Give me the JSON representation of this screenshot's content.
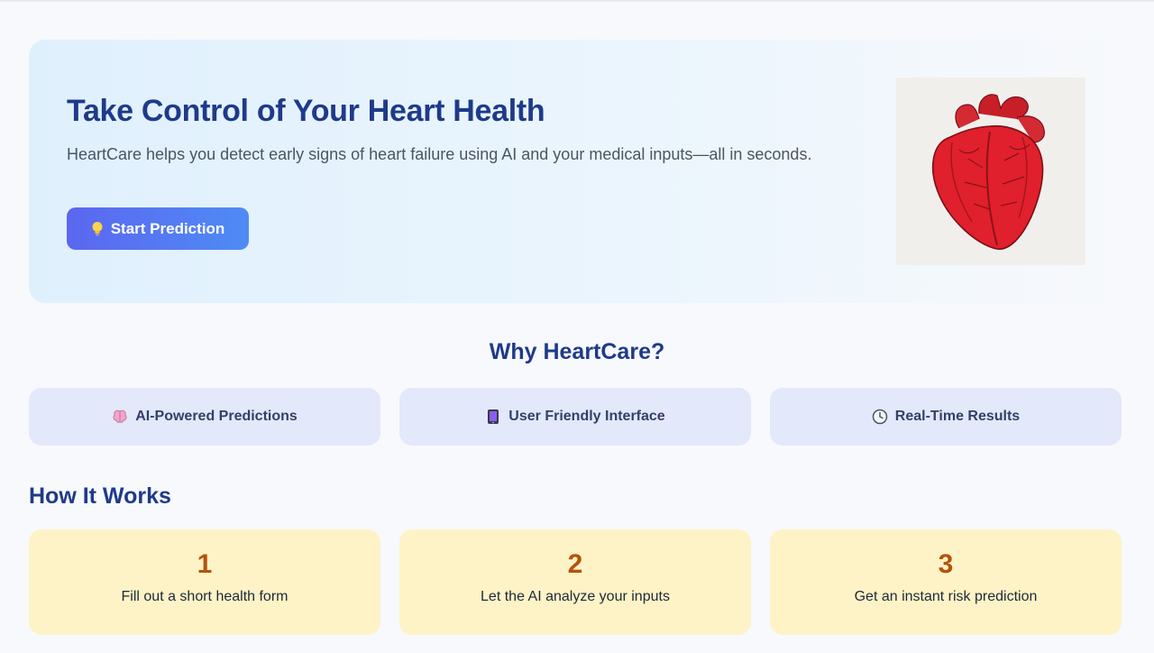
{
  "hero": {
    "title": "Take Control of Your Heart Health",
    "subtitle": "HeartCare helps you detect early signs of heart failure using AI and your medical inputs—all in seconds.",
    "cta_label": "Start Prediction",
    "cta_icon": "lightbulb-icon",
    "image": "anatomical-heart-illustration"
  },
  "why": {
    "title": "Why HeartCare?",
    "features": [
      {
        "icon": "brain-icon",
        "label": "AI-Powered Predictions"
      },
      {
        "icon": "tablet-icon",
        "label": "User Friendly Interface"
      },
      {
        "icon": "clock-icon",
        "label": "Real-Time Results"
      }
    ]
  },
  "how": {
    "title": "How It Works",
    "steps": [
      {
        "number": "1",
        "text": "Fill out a short health form"
      },
      {
        "number": "2",
        "text": "Let the AI analyze your inputs"
      },
      {
        "number": "3",
        "text": "Get an instant risk prediction"
      }
    ]
  },
  "colors": {
    "primary_text": "#1f3a8a",
    "cta_start": "#5b67f0",
    "cta_end": "#4f8bf5",
    "feature_bg": "#e3e8fb",
    "step_bg": "#fef3c7",
    "step_number": "#b45309"
  }
}
